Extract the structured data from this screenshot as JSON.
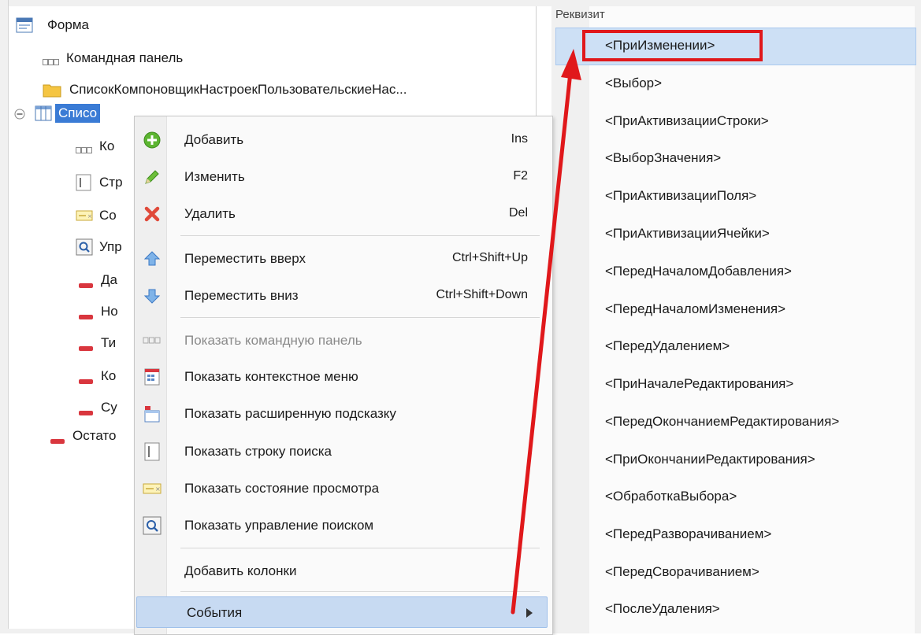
{
  "tree": {
    "items": [
      {
        "label": "Форма",
        "icon": "form-icon"
      },
      {
        "label": "Командная панель",
        "icon": "command-panel-icon"
      },
      {
        "label": "СписокКомпоновщикНастроекПользовательскиеНас...",
        "icon": "folder-icon"
      },
      {
        "label": "Списо",
        "icon": "table-icon",
        "selected": true
      },
      {
        "label": "Ко",
        "icon": "command-panel-icon"
      },
      {
        "label": "Стр",
        "icon": "search-string-icon"
      },
      {
        "label": "Со",
        "icon": "view-status-icon"
      },
      {
        "label": "Упр",
        "icon": "search-control-icon"
      },
      {
        "label": "Да",
        "icon": "attribute-icon"
      },
      {
        "label": "Но",
        "icon": "attribute-icon"
      },
      {
        "label": "Ти",
        "icon": "attribute-icon"
      },
      {
        "label": "Ко",
        "icon": "attribute-icon"
      },
      {
        "label": "Су",
        "icon": "attribute-icon"
      },
      {
        "label": "Остато",
        "icon": "attribute-icon"
      }
    ]
  },
  "events_panel": {
    "header": "Реквизит",
    "items": [
      "<ПриИзменении>",
      "<Выбор>",
      "<ПриАктивизацииСтроки>",
      "<ВыборЗначения>",
      "<ПриАктивизацииПоля>",
      "<ПриАктивизацииЯчейки>",
      "<ПередНачаломДобавления>",
      "<ПередНачаломИзменения>",
      "<ПередУдалением>",
      "<ПриНачалеРедактирования>",
      "<ПередОкончаниемРедактирования>",
      "<ПриОкончанииРедактирования>",
      "<ОбработкаВыбора>",
      "<ПередРазворачиванием>",
      "<ПередСворачиванием>",
      "<ПослеУдаления>"
    ]
  },
  "context_menu": {
    "items": [
      {
        "label": "Добавить",
        "shortcut": "Ins",
        "icon": "add-icon"
      },
      {
        "label": "Изменить",
        "shortcut": "F2",
        "icon": "edit-icon"
      },
      {
        "label": "Удалить",
        "shortcut": "Del",
        "icon": "delete-icon"
      },
      {
        "label": "Переместить вверх",
        "shortcut": "Ctrl+Shift+Up",
        "icon": "move-up-icon"
      },
      {
        "label": "Переместить вниз",
        "shortcut": "Ctrl+Shift+Down",
        "icon": "move-down-icon"
      },
      {
        "label": "Показать командную панель",
        "shortcut": "",
        "icon": "command-panel-icon",
        "disabled": true
      },
      {
        "label": "Показать контекстное меню",
        "shortcut": "",
        "icon": "context-menu-icon"
      },
      {
        "label": "Показать расширенную подсказку",
        "shortcut": "",
        "icon": "extended-tooltip-icon"
      },
      {
        "label": "Показать строку поиска",
        "shortcut": "",
        "icon": "search-string-icon"
      },
      {
        "label": "Показать состояние просмотра",
        "shortcut": "",
        "icon": "view-status-icon"
      },
      {
        "label": "Показать управление поиском",
        "shortcut": "",
        "icon": "search-control-icon"
      },
      {
        "label": "Добавить колонки",
        "shortcut": "",
        "icon": ""
      },
      {
        "label": "События",
        "shortcut": "",
        "icon": "",
        "submenu": true
      }
    ]
  },
  "colors": {
    "selection": "#3a7bd5",
    "menu_highlight": "#c7daf2",
    "annotation_red": "#e0181b",
    "attribute_red": "#d9363e"
  }
}
